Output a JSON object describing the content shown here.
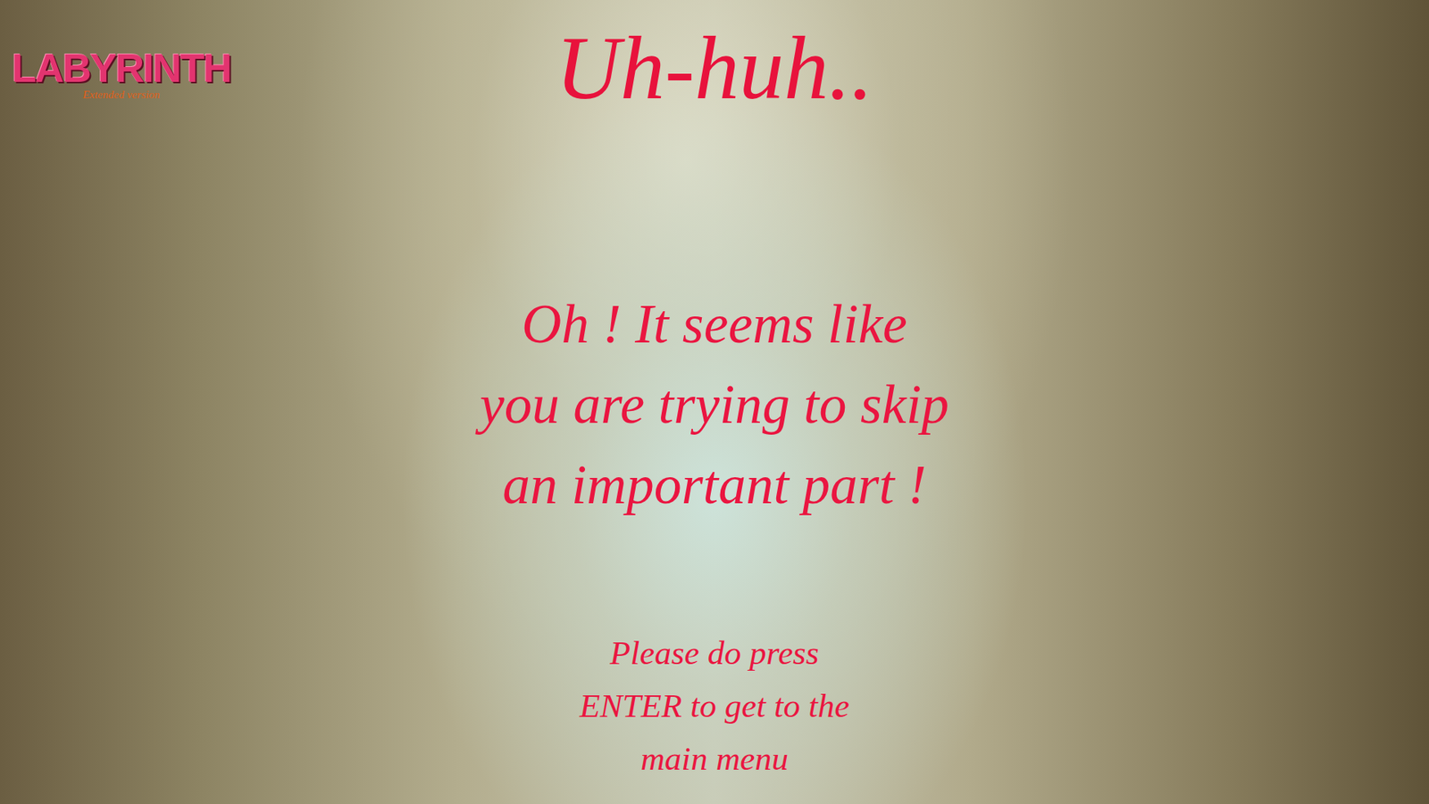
{
  "logo": {
    "title": "LABYRINTH",
    "subtitle": "Extended version"
  },
  "heading": "Uh-huh..",
  "message": [
    "Oh ! It seems like",
    "you are trying to skip",
    "an important part !"
  ],
  "prompt": [
    "Please do press",
    "ENTER to get to the",
    "main menu"
  ]
}
